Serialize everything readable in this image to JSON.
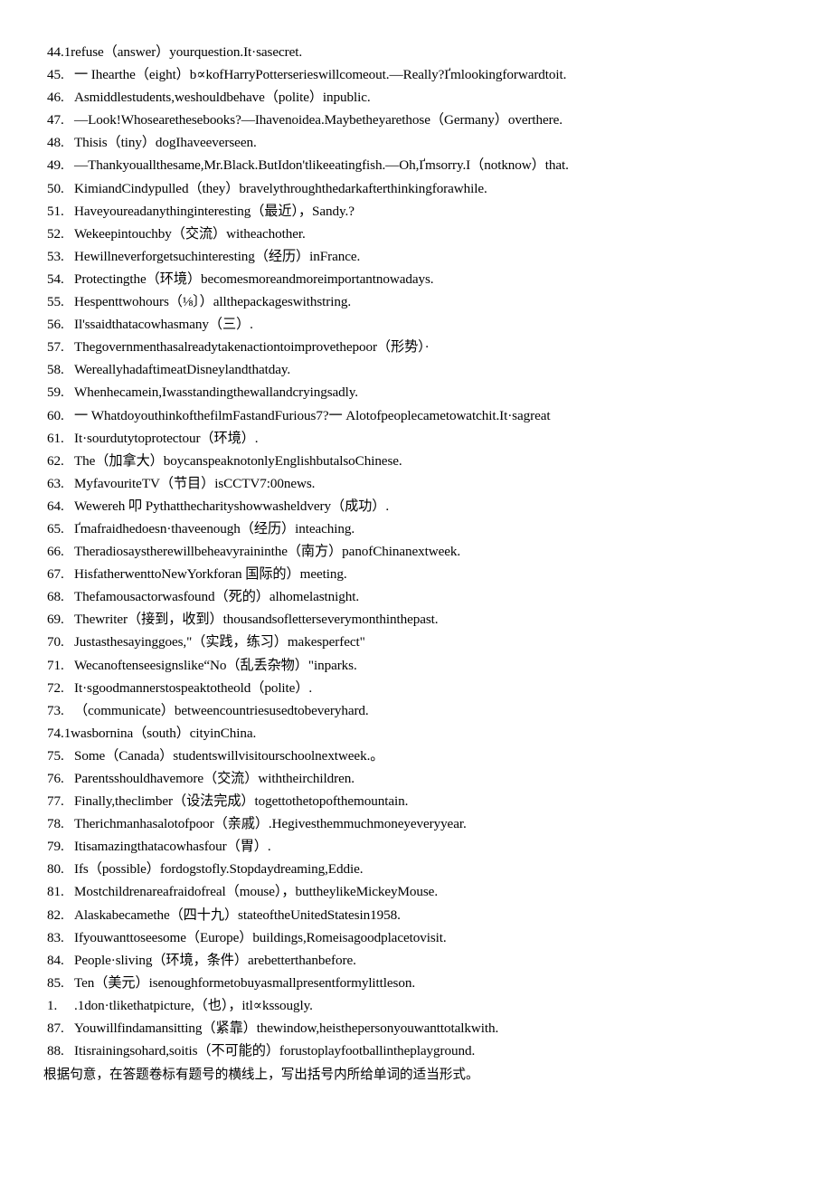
{
  "document": {
    "type": "english-grammar-worksheet",
    "instruction_note": "根据句意，在答题卷标有题号的横线上，写出括号内所给单词的适当形式。"
  },
  "items": [
    {
      "num": "44.",
      "layout": "run-on",
      "text": "1refuse（answer）yourquestion.It·sasecret."
    },
    {
      "num": "45.",
      "layout": "indent",
      "text": "一 Ihearthe（eight）b∝kofHarryPotterserieswillcomeout.—Really?Ґmlookingforwardtoit."
    },
    {
      "num": "46.",
      "layout": "indent",
      "text": "Asmiddlestudents,weshouldbehave（polite）inpublic."
    },
    {
      "num": "47.",
      "layout": "indent",
      "text": "—Look!Whosearethesebooks?—Ihavenoidea.Maybetheyarethose（Germany）overthere."
    },
    {
      "num": "48.",
      "layout": "indent",
      "text": "Thisis（tiny）dogIhaveeverseen."
    },
    {
      "num": "49.",
      "layout": "indent",
      "text": "—Thankyouallthesame,Mr.Black.ButIdon'tlikeeatingfish.—Oh,Ґmsorry.I（notknow）that."
    },
    {
      "num": "50.",
      "layout": "indent",
      "text": "KimiandCindypulled（they）bravelythroughthedarkafterthinkingforawhile."
    },
    {
      "num": "51.",
      "layout": "indent",
      "text": "Haveyoureadanythinginteresting（最近），Sandy.?"
    },
    {
      "num": "52.",
      "layout": "indent",
      "text": "Wekeepintouchby（交流）witheachother."
    },
    {
      "num": "53.",
      "layout": "indent",
      "text": "Hewillneverforgetsuchinteresting（经历）inFrance."
    },
    {
      "num": "54.",
      "layout": "indent",
      "text": "Protectingthe（环境）becomesmoreandmoreimportantnowadays."
    },
    {
      "num": "55.",
      "layout": "indent",
      "text": "Hespenttwohours（⅛〕）allthepackageswithstring."
    },
    {
      "num": "56.",
      "layout": "indent",
      "text": "Il'ssaidthatacowhasmany（三）."
    },
    {
      "num": "57.",
      "layout": "indent",
      "text": "Thegovernmenthasalreadytakenactiontoimprovethepoor（形势）·"
    },
    {
      "num": "58.",
      "layout": "indent",
      "text": "WereallyhadaftimeatDisneylandthatday."
    },
    {
      "num": "59.",
      "layout": "indent",
      "text": "Whenhecamein,Iwasstandingthewallandcryingsadly."
    },
    {
      "num": "60.",
      "layout": "indent",
      "text": "一 WhatdoyouthinkofthefilmFastandFurious7?一 Alotofpeoplecametowatchit.It·sagreat"
    },
    {
      "num": "61.",
      "layout": "indent",
      "text": "It·sourdutytoprotectour（环境）."
    },
    {
      "num": "62.",
      "layout": "indent",
      "text": "The（加拿大）boycanspeaknotonlyEnglishbutalsoChinese."
    },
    {
      "num": "63.",
      "layout": "indent",
      "text": "MyfavouriteTV（节目）isCCTV7:00news."
    },
    {
      "num": "64.",
      "layout": "indent",
      "text": "Wewereh 叩 Pythatthecharityshowwasheldvery（成功）."
    },
    {
      "num": "65.",
      "layout": "indent",
      "text": "Ґmafraidhedoesn·thaveenough（经历）inteaching."
    },
    {
      "num": "66.",
      "layout": "indent",
      "text": "Theradiosaystherewillbeheavyraininthe（南方）panofChinanextweek."
    },
    {
      "num": "67.",
      "layout": "indent",
      "text": "HisfatherwenttoNewYorkforan 国际的）meeting."
    },
    {
      "num": "68.",
      "layout": "indent",
      "text": "Thefamousactorwasfound（死的）alhomelastnight."
    },
    {
      "num": "69.",
      "layout": "indent",
      "text": "Thewriter（接到，收到）thousandsofletterseverymonthinthepast."
    },
    {
      "num": "70.",
      "layout": "indent",
      "text": "Justasthesayinggoes,\"（实践，练习）makesperfect\""
    },
    {
      "num": "71.",
      "layout": "indent",
      "text": "Wecanoftenseesignslike“No（乱丢杂物）\"inparks."
    },
    {
      "num": "72.",
      "layout": "indent",
      "text": "It·sgoodmannerstospeaktotheold（polite）."
    },
    {
      "num": "73.",
      "layout": "indent",
      "text": "（communicate）betweencountriesusedtobeveryhard."
    },
    {
      "num": "74.",
      "layout": "run-on",
      "text": "1wasbornina（south）cityinChina."
    },
    {
      "num": "75.",
      "layout": "indent",
      "text": "Some（Canada）studentswillvisitourschoolnextweek.。"
    },
    {
      "num": "76.",
      "layout": "indent",
      "text": "Parentsshouldhavemore（交流）withtheirchildren."
    },
    {
      "num": "77.",
      "layout": "indent",
      "text": "Finally,theclimber（设法完成）togettothetopofthemountain."
    },
    {
      "num": "78.",
      "layout": "indent",
      "text": "Therichmanhasalotofpoor（亲戚）.Hegivesthemmuchmoneyeveryyear."
    },
    {
      "num": "79.",
      "layout": "indent",
      "text": "Itisamazingthatacowhasfour（胃）."
    },
    {
      "num": "80.",
      "layout": "indent",
      "text": "Ifs（possible）fordogstofly.Stopdaydreaming,Eddie."
    },
    {
      "num": "81.",
      "layout": "indent",
      "text": "Mostchildrenareafraidofreal（mouse），buttheylikeMickeyMouse."
    },
    {
      "num": "82.",
      "layout": "indent",
      "text": "Alaskabecamethe（四十九）stateoftheUnitedStatesin1958."
    },
    {
      "num": "83.",
      "layout": "indent",
      "text": "Ifyouwanttoseesome（Europe）buildings,Romeisagoodplacetovisit."
    },
    {
      "num": "84.",
      "layout": "indent",
      "text": "People·sliving（环境，条件）arebetterthanbefore."
    },
    {
      "num": "85.",
      "layout": "indent",
      "text": "Ten（美元）isenoughformetobuyasmallpresentformylittleson."
    },
    {
      "num": "1.",
      "layout": "indent",
      "text": ".1don·tlikethatpicture,（也），itl∝kssougly."
    },
    {
      "num": "87.",
      "layout": "indent",
      "text": "Youwillfindamansitting（紧靠）thewindow,heisthepersonyouwanttotalkwith."
    },
    {
      "num": "88.",
      "layout": "indent",
      "text": "Itisrainingsohard,soitis（不可能的）forustoplayfootballintheplayground."
    }
  ]
}
